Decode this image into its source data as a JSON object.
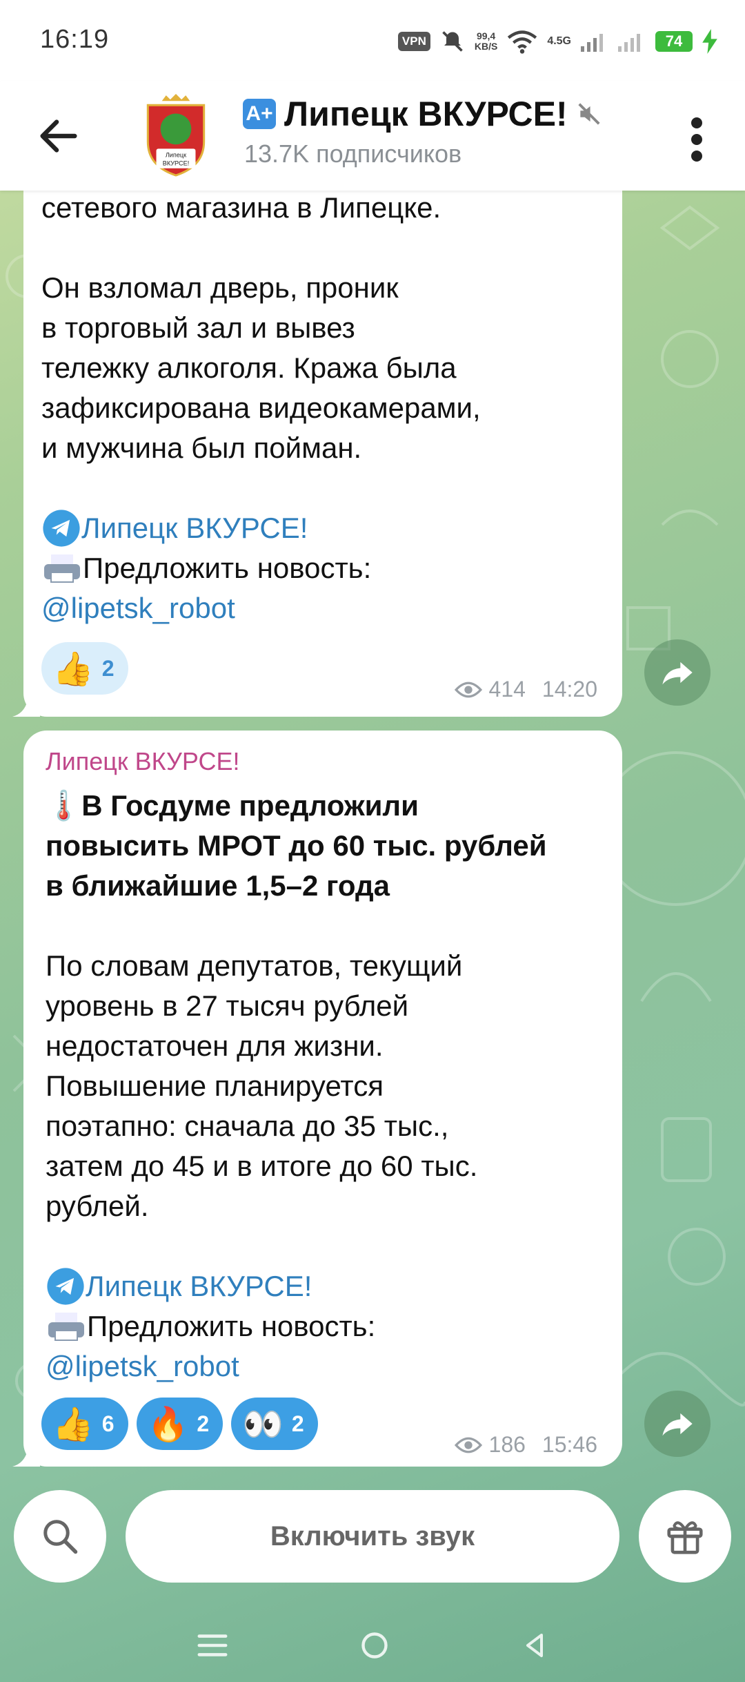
{
  "status_bar": {
    "time": "16:19",
    "vpn": "VPN",
    "speed_value": "99,4",
    "speed_unit": "KB/S",
    "network": "4.5G",
    "battery": "74"
  },
  "header": {
    "title_badge": "A+",
    "title": "Липецк ВКУРСЕ!",
    "subscribers": "13.7K подписчиков",
    "avatar_text_1": "Липецк",
    "avatar_text_2": "ВКУРСЕ!"
  },
  "messages": [
    {
      "lines": [
        "сетевого магазина в Липецке.",
        "",
        "Он взломал дверь, проник",
        "в торговый зал и вывез",
        "тележку алкоголя. Кража была",
        "зафиксирована видеокамерами,",
        "и мужчина был пойман."
      ],
      "channel_link": "Липецк ВКУРСЕ!",
      "suggest_label": "Предложить новость:",
      "bot_link": "@lipetsk_robot",
      "reactions": [
        {
          "emoji": "👍",
          "count": "2"
        }
      ],
      "views": "414",
      "time": "14:20"
    },
    {
      "author": "Липецк ВКУРСЕ!",
      "headline_emoji": "🌡️",
      "headline": [
        "В Госдуме предложили",
        "повысить МРОТ до 60 тыс. рублей",
        "в ближайшие 1,5–2 года"
      ],
      "lines": [
        "По словам депутатов, текущий",
        "уровень в 27 тысяч рублей",
        "недостаточен для жизни.",
        "Повышение планируется",
        "поэтапно: сначала до 35 тыс.,",
        "затем до 45 и в итоге до 60 тыс.",
        "рублей."
      ],
      "channel_link": "Липецк ВКУРСЕ!",
      "suggest_label": "Предложить новость:",
      "bot_link": "@lipetsk_robot",
      "reactions": [
        {
          "emoji": "👍",
          "count": "6"
        },
        {
          "emoji": "🔥",
          "count": "2"
        },
        {
          "emoji": "👀",
          "count": "2"
        }
      ],
      "views": "186",
      "time": "15:46"
    }
  ],
  "bottom": {
    "sound_label": "Включить звук"
  },
  "colors": {
    "link": "#2f7fbd",
    "author": "#c0478a",
    "reaction_active": "#3d9fe4"
  }
}
